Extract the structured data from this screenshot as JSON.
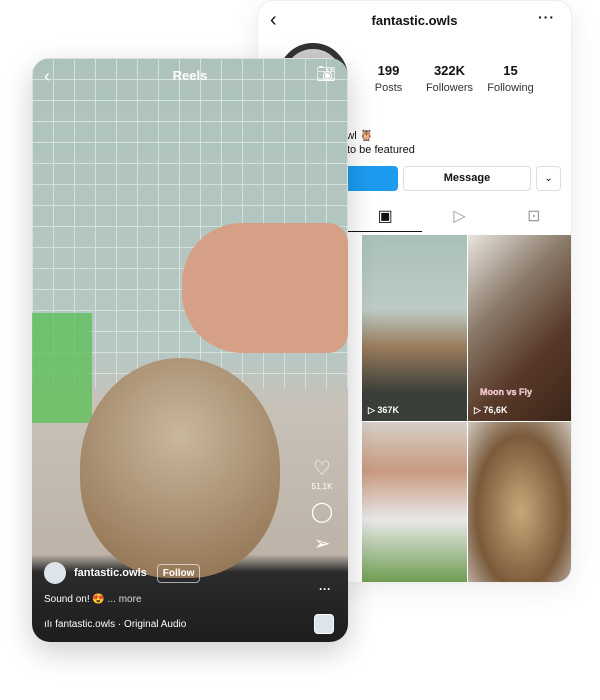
{
  "profile": {
    "username": "fantastic.owls",
    "stats": [
      {
        "value": "199",
        "label": "Posts"
      },
      {
        "value": "322K",
        "label": "Followers"
      },
      {
        "value": "15",
        "label": "Following"
      }
    ],
    "bio_lines": [
      "te owl 🦉",
      "wls to be featured"
    ],
    "message_label": "Message",
    "grid": [
      {
        "views": "367K",
        "caption": ""
      },
      {
        "views": "76,6K",
        "caption": "Moon vs Fly"
      },
      {
        "views": "",
        "caption": ""
      },
      {
        "views": "",
        "caption": ""
      }
    ]
  },
  "reel": {
    "title": "Reels",
    "likes": "51,1K",
    "username": "fantastic.owls",
    "follow_label": "Follow",
    "caption": "Sound on! 😍",
    "more": "... more",
    "audio": "fantastic.owls · Original Audio"
  },
  "colors": {
    "accent": "#1d9bf0"
  }
}
